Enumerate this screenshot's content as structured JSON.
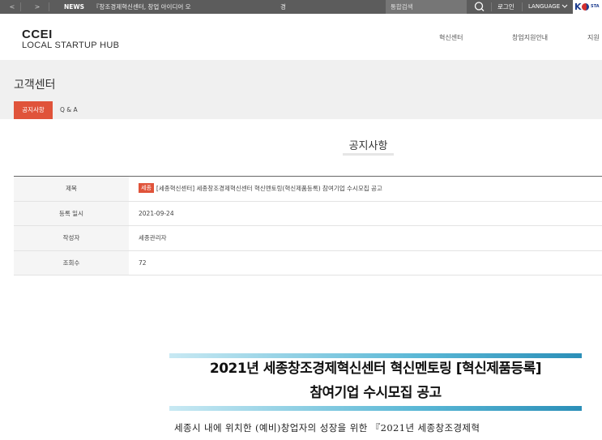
{
  "topbar": {
    "prev_label": "<",
    "next_label": ">",
    "news_label": "NEWS",
    "news_text": "『창조경제혁신센터, 창업 아이디어 오",
    "news_extra": "경",
    "search_label": "통합검색",
    "search_icon": "search-icon",
    "login_label": "로그인",
    "language_label": "LANGUAGE",
    "language_icon": "chevron-down-icon",
    "partner_logo_text": "K",
    "partner_logo_sub": "STA"
  },
  "header": {
    "brand_line1": "CCEI",
    "brand_line2": "LOCAL STARTUP HUB",
    "nav": [
      "혁신센터",
      "창업지원안내",
      "지원"
    ]
  },
  "page": {
    "title": "고객센터",
    "tabs": [
      {
        "label": "공지사항",
        "active": true
      },
      {
        "label": "Q & A",
        "active": false
      }
    ]
  },
  "section_title": "공지사항",
  "post": {
    "rows": [
      {
        "label": "제목",
        "badge": "세종",
        "value": "[세종혁신센터] 세종창조경제혁신센터 혁신멘토링(혁신제품등록) 참여기업 수시모집 공고"
      },
      {
        "label": "등록 일시",
        "value": "2021-09-24"
      },
      {
        "label": "작성자",
        "value": "세종관리자"
      },
      {
        "label": "조회수",
        "value": "72"
      }
    ]
  },
  "notice_image": {
    "line1": "2021년 세종창조경제혁신센터 혁신멘토링 [혁신제품등록]",
    "line2": "참여기업 수시모집 공고"
  },
  "body_text": "세종시 내에 위치한 (예비)창업자의 성장을 위한 『2021년 세종창조경제혁",
  "colors": {
    "accent": "#e0533a",
    "topbar": "#5c5c5c",
    "band": "#f0f0f0"
  }
}
